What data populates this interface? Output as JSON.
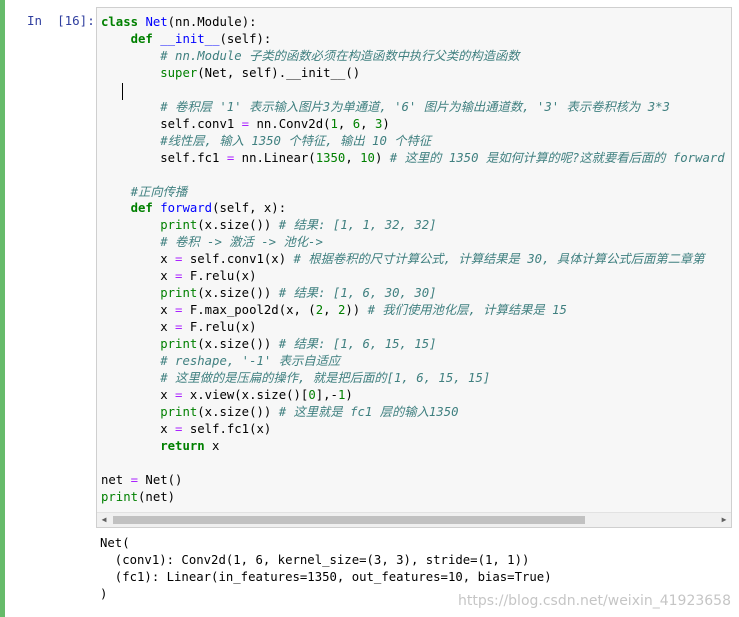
{
  "cell": {
    "prompt": "In  [16]:",
    "accent_color": "#66bb6a",
    "code_lines": [
      "class Net(nn.Module):",
      "    def __init__(self):",
      "        # nn.Module 子类的函数必须在构造函数中执行父类的构造函数",
      "        super(Net, self).__init__()",
      "",
      "        # 卷积层 '1' 表示输入图片3为单通道, '6' 图片为输出通道数, '3' 表示卷积核为 3*3",
      "        self.conv1 = nn.Conv2d(1, 6, 3)",
      "        #线性层, 输入 1350 个特征, 输出 10 个特征",
      "        self.fc1 = nn.Linear(1350, 10) # 这里的 1350 是如何计算的呢?这就要看后面的 forward",
      "",
      "    #正向传播",
      "    def forward(self, x):",
      "        print(x.size()) # 结果: [1, 1, 32, 32]",
      "        # 卷积 -> 激活 -> 池化->",
      "        x = self.conv1(x) # 根据卷积的尺寸计算公式, 计算结果是 30, 具体计算公式后面第二章第",
      "        x = F.relu(x)",
      "        print(x.size()) # 结果: [1, 6, 30, 30]",
      "        x = F.max_pool2d(x, (2, 2)) # 我们使用池化层, 计算结果是 15",
      "        x = F.relu(x)",
      "        print(x.size()) # 结果: [1, 6, 15, 15]",
      "        # reshape, '-1' 表示自适应",
      "        # 这里做的是压扁的操作, 就是把后面的[1, 6, 15, 15]",
      "        x = x.view(x.size()[0],-1)",
      "        print(x.size()) # 这里就是 fc1 层的输入1350",
      "        x = self.fc1(x)",
      "        return x",
      "",
      "net = Net()",
      "print(net)"
    ]
  },
  "output": {
    "lines": [
      "Net(",
      "  (conv1): Conv2d(1, 6, kernel_size=(3, 3), stride=(1, 1))",
      "  (fc1): Linear(in_features=1350, out_features=10, bias=True)",
      ")"
    ]
  },
  "scrollbar": {
    "left_arrow": "◀",
    "right_arrow": "▶"
  },
  "watermark": "https://blog.csdn.net/weixin_41923658"
}
